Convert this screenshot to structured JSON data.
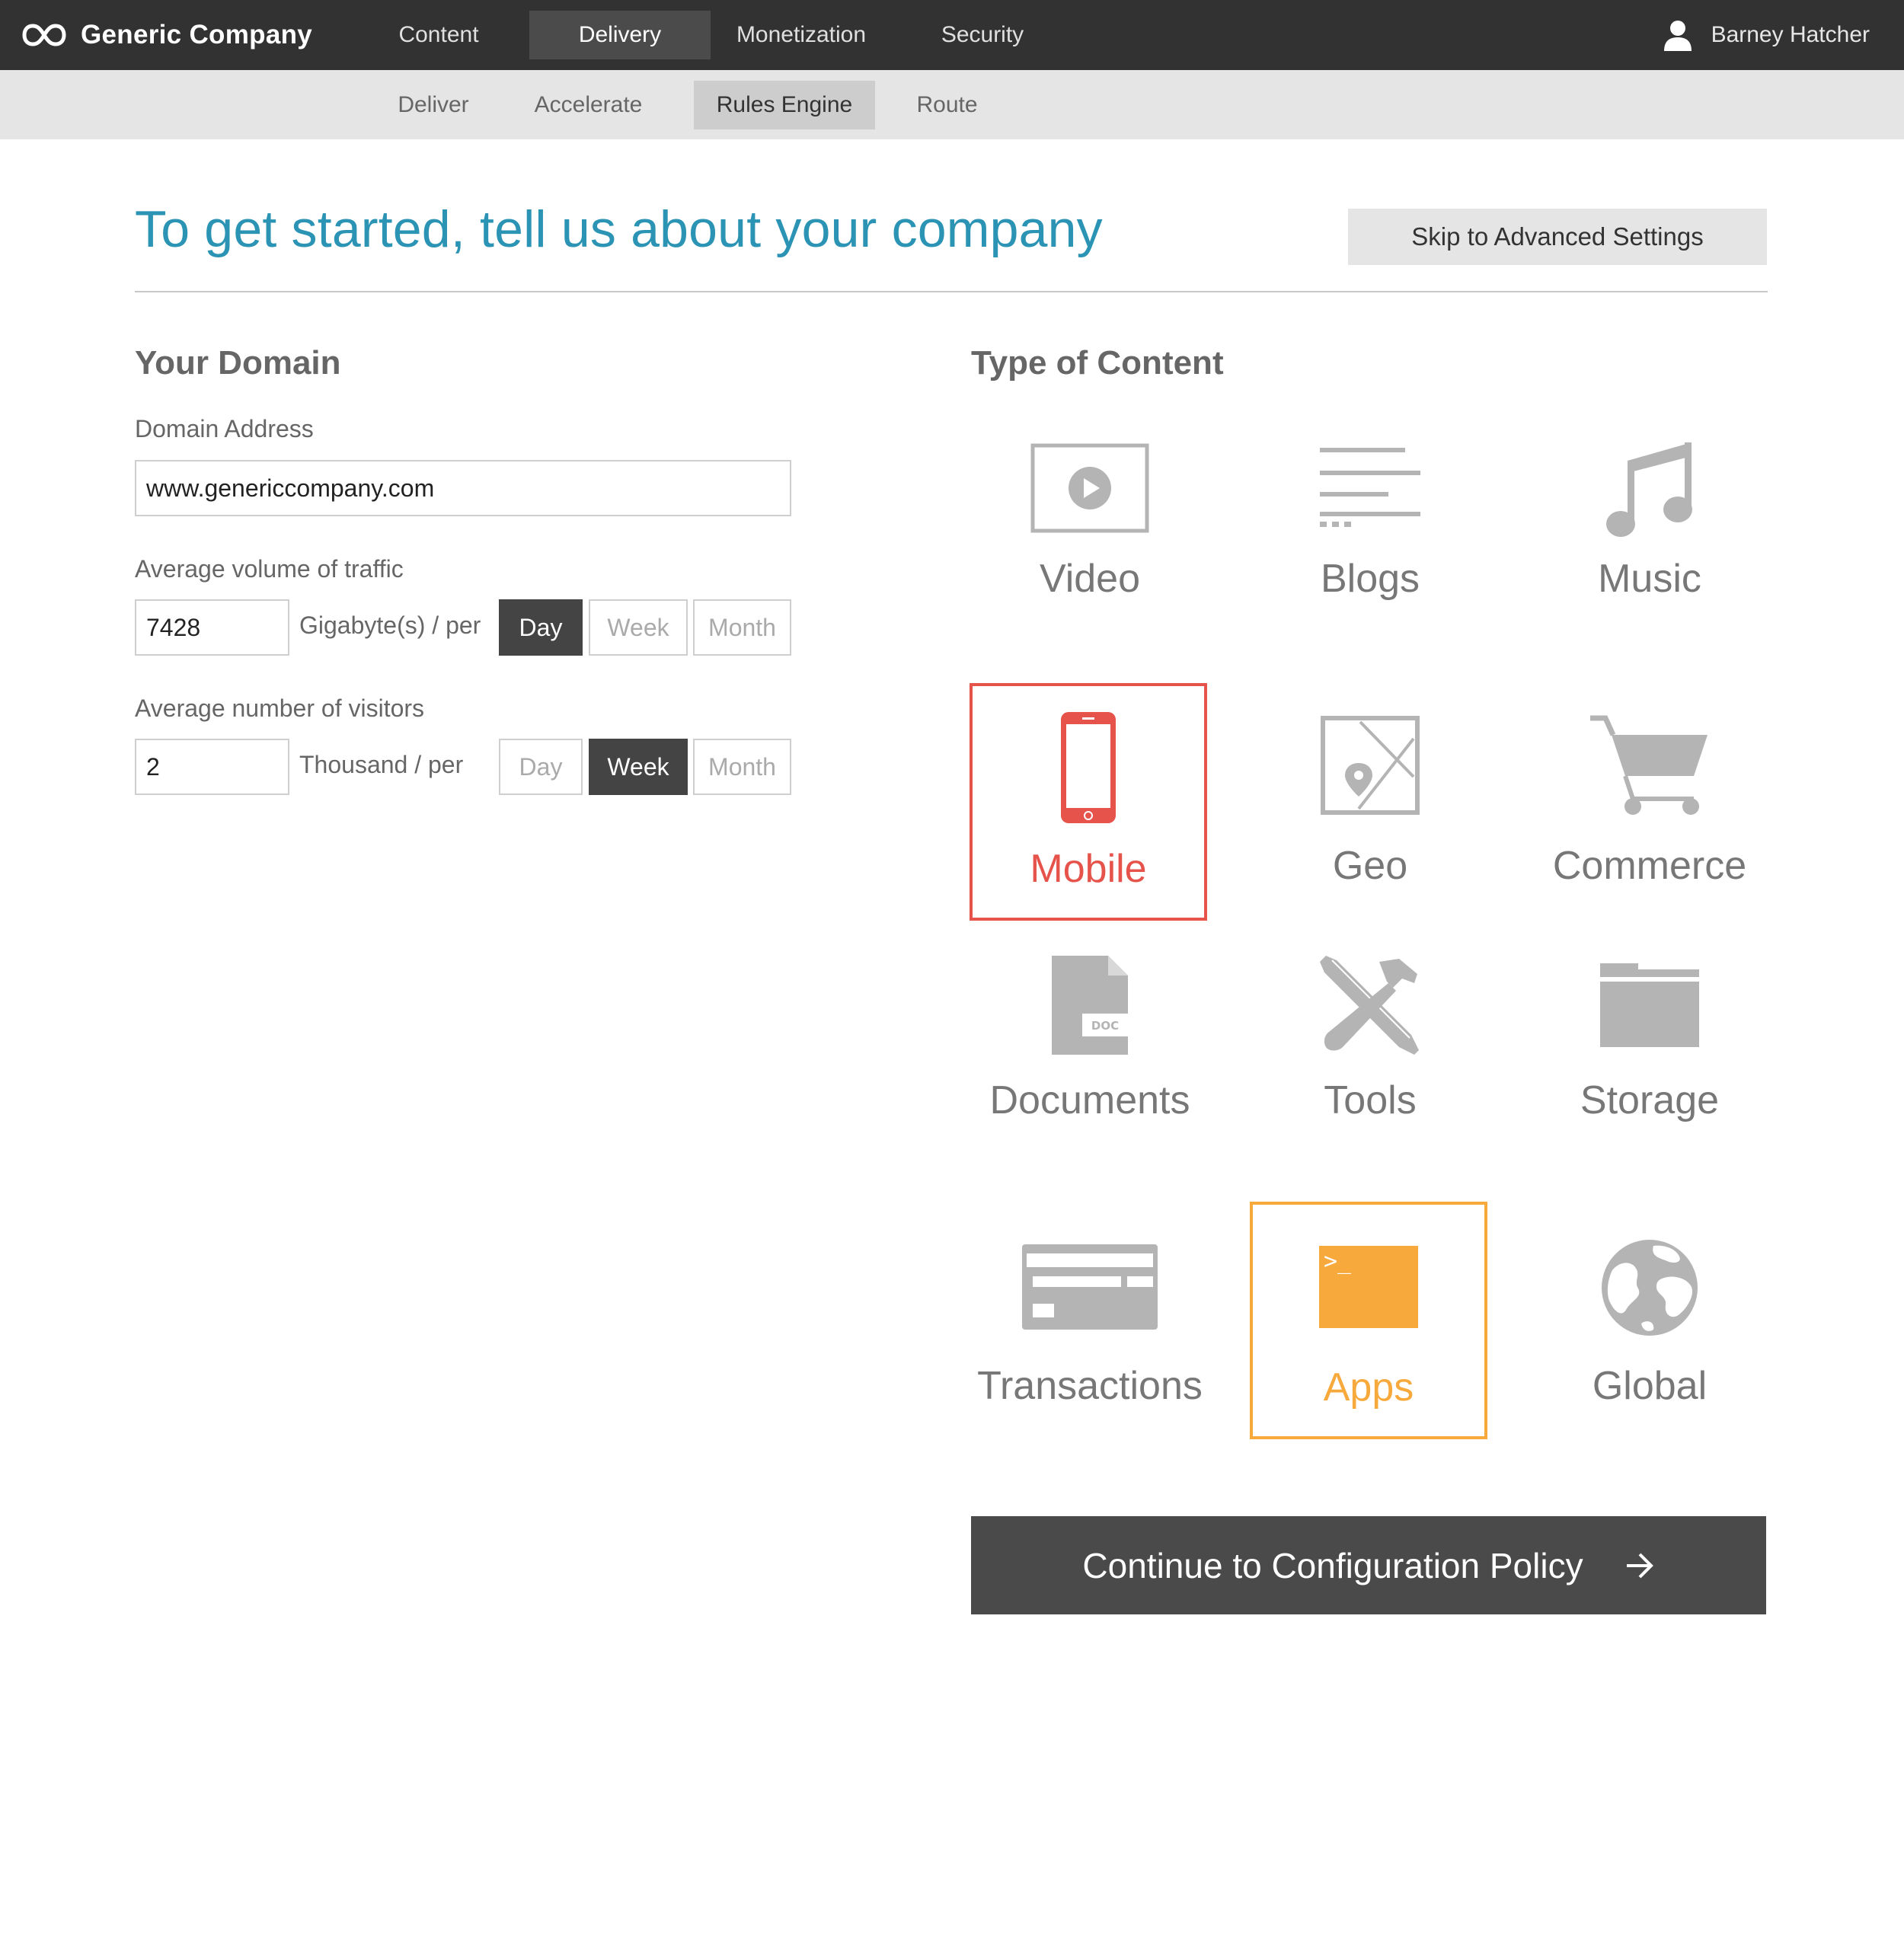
{
  "brand": {
    "name": "Generic Company"
  },
  "top_nav": [
    {
      "label": "Content"
    },
    {
      "label": "Delivery",
      "active": true
    },
    {
      "label": "Monetization"
    },
    {
      "label": "Security"
    }
  ],
  "user": {
    "name": "Barney Hatcher"
  },
  "sub_nav": [
    {
      "label": "Deliver"
    },
    {
      "label": "Accelerate"
    },
    {
      "label": "Rules Engine",
      "active": true
    },
    {
      "label": "Route"
    }
  ],
  "page": {
    "title": "To get started, tell us about your company",
    "skip_label": "Skip to Advanced Settings"
  },
  "domain": {
    "section_title": "Your Domain",
    "address_label": "Domain Address",
    "address_value": "www.genericcompany.com",
    "traffic_label": "Average volume of traffic",
    "traffic_value": "7428",
    "traffic_unit": "Gigabyte(s) / per",
    "traffic_periods": [
      "Day",
      "Week",
      "Month"
    ],
    "traffic_selected": "Day",
    "visitors_label": "Average number of visitors",
    "visitors_value": "2",
    "visitors_unit": "Thousand / per",
    "visitors_periods": [
      "Day",
      "Week",
      "Month"
    ],
    "visitors_selected": "Week"
  },
  "content_types": {
    "section_title": "Type of Content",
    "items": [
      {
        "label": "Video",
        "icon": "video-icon"
      },
      {
        "label": "Blogs",
        "icon": "blogs-icon"
      },
      {
        "label": "Music",
        "icon": "music-icon"
      },
      {
        "label": "Mobile",
        "icon": "mobile-icon",
        "selected": true
      },
      {
        "label": "Geo",
        "icon": "map-icon"
      },
      {
        "label": "Commerce",
        "icon": "cart-icon"
      },
      {
        "label": "Documents",
        "icon": "document-icon"
      },
      {
        "label": "Tools",
        "icon": "tools-icon"
      },
      {
        "label": "Storage",
        "icon": "folder-icon"
      },
      {
        "label": "Transactions",
        "icon": "credit-card-icon"
      },
      {
        "label": "Apps",
        "icon": "terminal-icon",
        "selected": true
      },
      {
        "label": "Global",
        "icon": "globe-icon"
      }
    ],
    "doc_badge": "DOC",
    "terminal_prompt": ">_"
  },
  "colors": {
    "accent_title": "#2b93b3",
    "topbar": "#323232",
    "selected_mobile": "#e5534b",
    "selected_apps": "#f7a93c",
    "icon_gray": "#b4b4b4"
  },
  "continue_label": "Continue to Configuration Policy"
}
